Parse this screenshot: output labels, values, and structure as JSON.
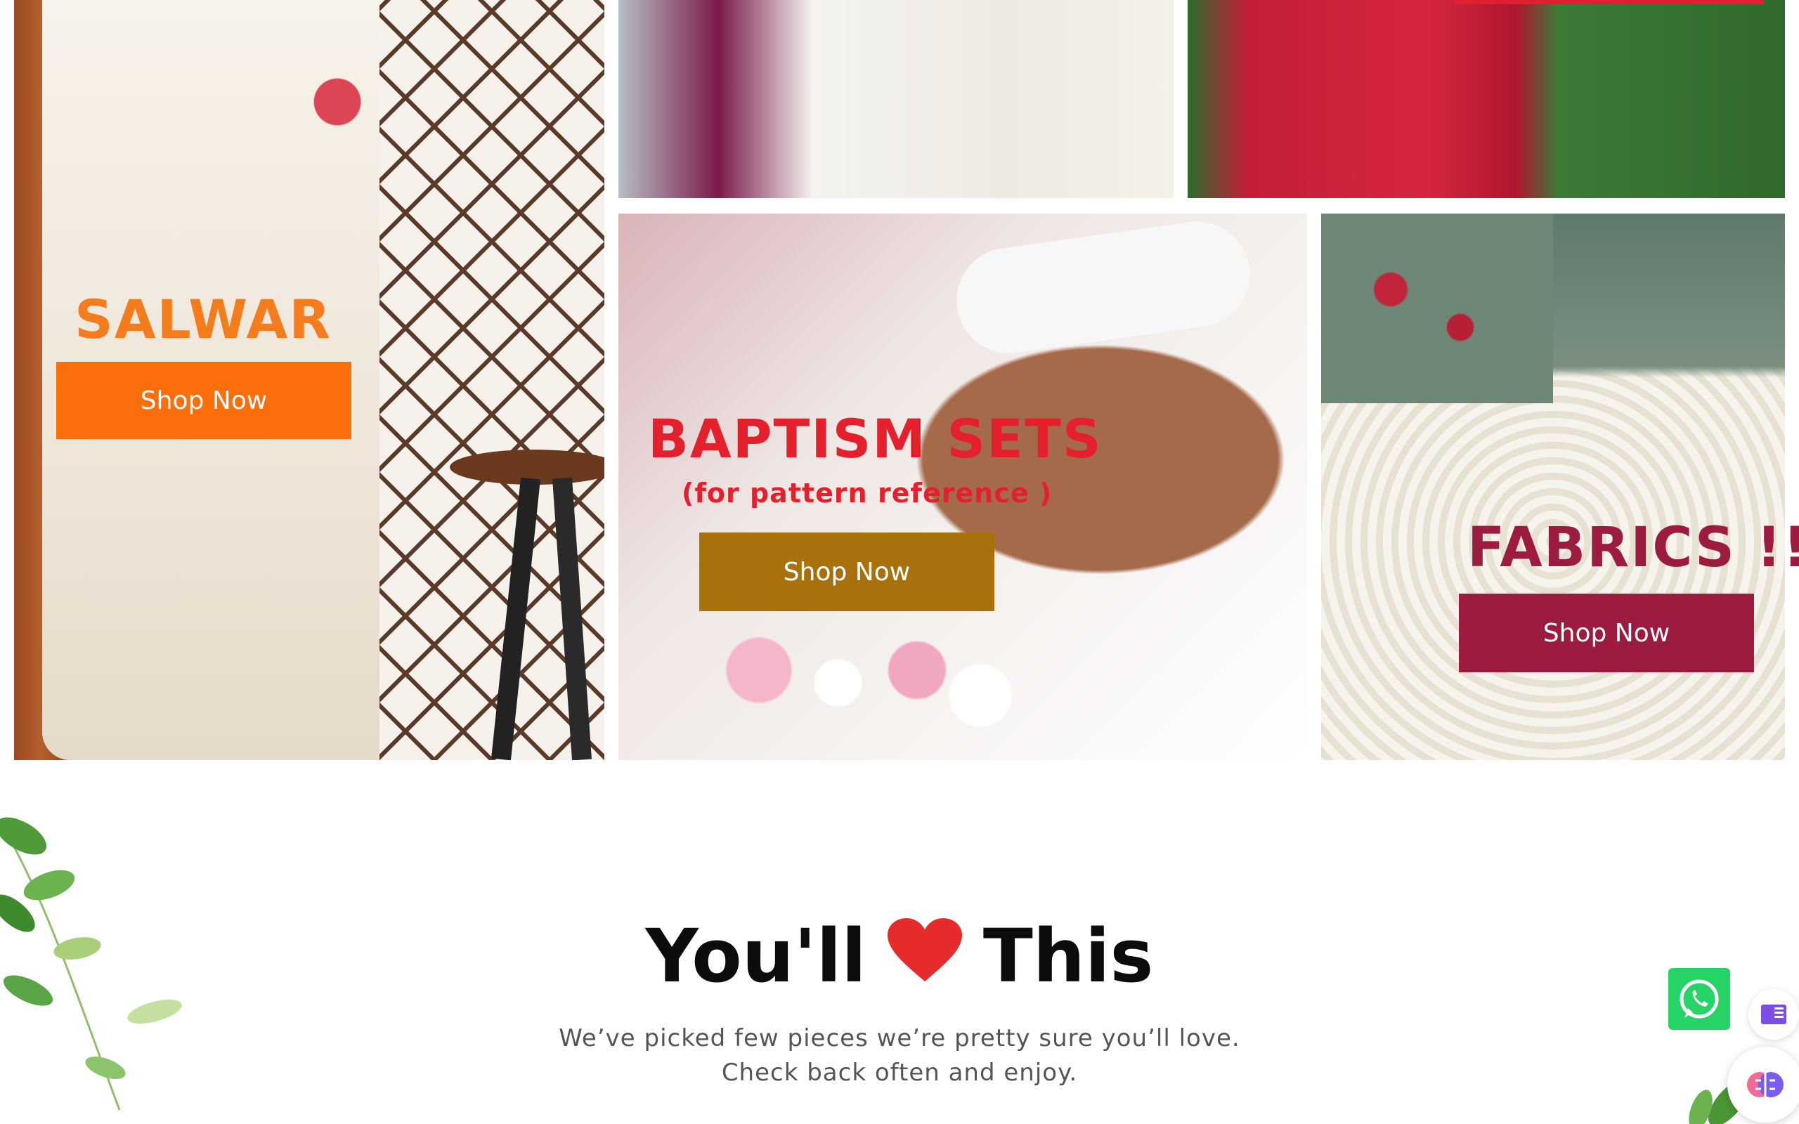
{
  "tiles": {
    "salwar": {
      "title": "SALWAR",
      "button": "Shop Now"
    },
    "baptism": {
      "title": "BAPTISM SETS",
      "subtitle": "(for pattern reference )",
      "button": "Shop Now"
    },
    "fabrics": {
      "title": "FABRICS !!",
      "button": "Shop Now"
    }
  },
  "section": {
    "title_before": "You'll",
    "title_after": "This",
    "heart_icon": "heart-icon",
    "line1": "We’ve picked few pieces we’re pretty sure you’ll love.",
    "line2": "Check back often and enjoy."
  },
  "widgets": {
    "whatsapp_icon": "whatsapp-icon",
    "reader_icon": "book-icon",
    "assistant_icon": "brain-icon"
  },
  "colors": {
    "salwar_title": "#f47c1c",
    "salwar_button": "#fb6e0c",
    "baptism_title": "#e3202b",
    "baptism_button": "#a8710c",
    "fabrics_title": "#9b1c3f",
    "fabrics_button": "#9b1c3f",
    "heart": "#e52b2b",
    "whatsapp": "#25d366"
  }
}
